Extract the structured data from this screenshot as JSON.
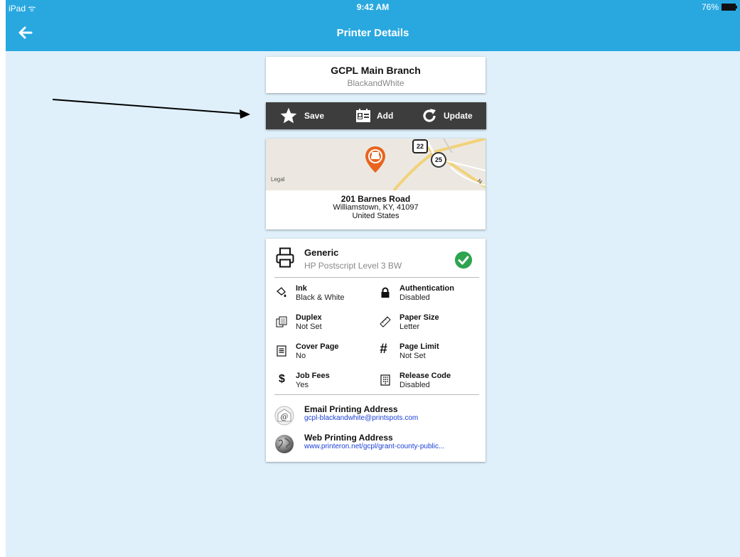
{
  "status_bar": {
    "carrier": "iPad",
    "time": "9:42 AM",
    "battery": "76%"
  },
  "nav": {
    "title": "Printer Details",
    "back_icon": "arrow-left-icon"
  },
  "printer": {
    "name": "GCPL Main Branch",
    "subtitle": "BlackandWhite"
  },
  "toolbar": {
    "save_label": "Save",
    "add_label": "Add",
    "update_label": "Update"
  },
  "map": {
    "legal_label": "Legal",
    "route_shields": [
      "22",
      "25"
    ],
    "road_letter": "N"
  },
  "address": {
    "line1": "201 Barnes Road",
    "line2": "Williamstown, KY, 41097",
    "line3": "United States"
  },
  "driver": {
    "name": "Generic",
    "model": "HP Postscript Level 3 BW"
  },
  "attributes": {
    "ink": {
      "label": "Ink",
      "value": "Black & White"
    },
    "authentication": {
      "label": "Authentication",
      "value": "Disabled"
    },
    "duplex": {
      "label": "Duplex",
      "value": "Not Set"
    },
    "paper_size": {
      "label": "Paper Size",
      "value": "Letter"
    },
    "cover_page": {
      "label": "Cover Page",
      "value": "No"
    },
    "page_limit": {
      "label": "Page Limit",
      "value": "Not Set"
    },
    "job_fees": {
      "label": "Job Fees",
      "value": "Yes"
    },
    "release_code": {
      "label": "Release Code",
      "value": "Disabled"
    }
  },
  "email_printing": {
    "label": "Email Printing Address",
    "value": "gcpl-blackandwhite@printspots.com"
  },
  "web_printing": {
    "label": "Web Printing Address",
    "value": "www.printeron.net/gcpl/grant-county-public..."
  },
  "colors": {
    "accent": "#29a8e0",
    "background": "#dff0fb",
    "toolbar": "#3d3d3d",
    "status_ok": "#2ea44f",
    "link": "#1a3ed8",
    "pin": "#e8641f"
  }
}
